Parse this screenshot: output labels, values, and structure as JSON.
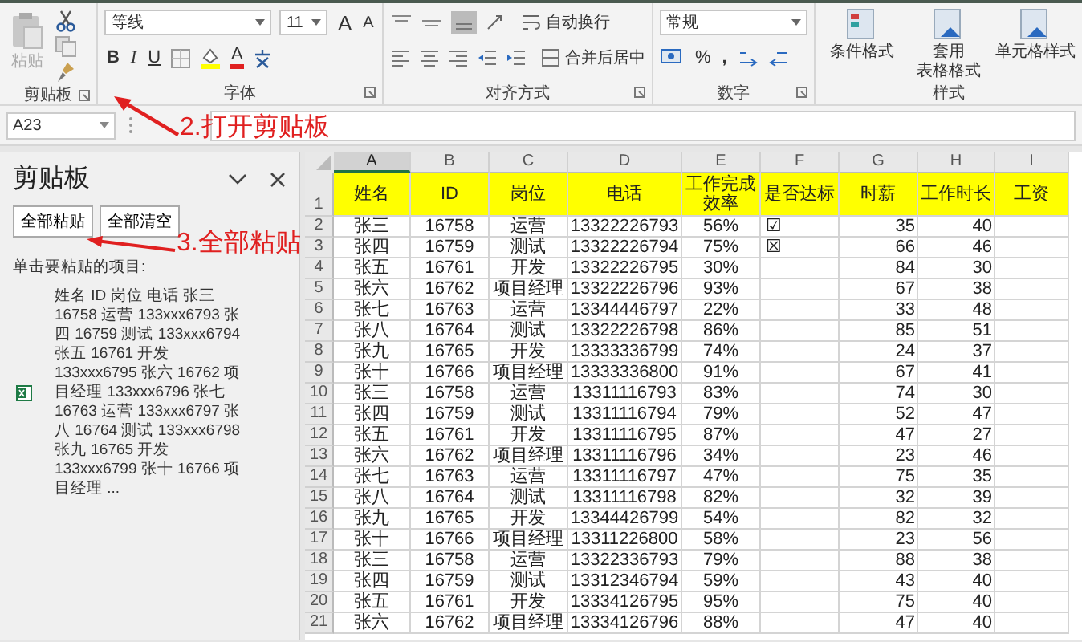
{
  "ribbon": {
    "clipboard": {
      "label": "剪贴板",
      "paste": {
        "label": "粘贴",
        "disabled": true
      }
    },
    "font": {
      "label": "字体",
      "font_name": "等线",
      "font_size": "11",
      "grow": "A",
      "shrink": "A",
      "bold": "B",
      "italic": "I",
      "underline": "U",
      "font_color": "A"
    },
    "alignment": {
      "label": "对齐方式",
      "wrap": "自动换行",
      "merge": "合并后居中"
    },
    "number": {
      "label": "数字",
      "format": "常规",
      "percent": "%",
      "comma": ","
    },
    "styles": {
      "label": "样式",
      "buttons": [
        {
          "lines": [
            "条件格式"
          ]
        },
        {
          "lines": [
            "套用",
            "表格格式"
          ]
        },
        {
          "lines": [
            "单元格样式"
          ]
        }
      ]
    }
  },
  "formula_bar": {
    "name_box": "A23"
  },
  "clipboard_pane": {
    "title": "剪贴板",
    "buttons": [
      "全部粘贴",
      "全部清空"
    ],
    "hint": "单击要粘贴的项目:",
    "items": [
      {
        "text": "姓名 ID 岗位 电话 张三 16758 运营 133xxx6793 张四 16759 测试 133xxx6794 张五 16761 开发 133xxx6795 张六 16762 项目经理 133xxx6796 张七 16763 运营 133xxx6797 张八 16764 测试 133xxx6798 张九 16765 开发 133xxx6799 张十 16766 项目经理 ..."
      }
    ]
  },
  "annotations": [
    {
      "text": "2.打开剪贴板"
    },
    {
      "text": "3.全部粘贴"
    }
  ],
  "sheet": {
    "columns": [
      {
        "label": "A",
        "selected": true
      },
      {
        "label": "B",
        "selected": false
      },
      {
        "label": "C",
        "selected": false
      },
      {
        "label": "D",
        "selected": false
      },
      {
        "label": "E",
        "selected": false
      },
      {
        "label": "F",
        "selected": false
      },
      {
        "label": "G",
        "selected": false
      },
      {
        "label": "H",
        "selected": false
      },
      {
        "label": "I",
        "selected": false
      }
    ],
    "header_row": "1",
    "header": [
      "姓名",
      "ID",
      "岗位",
      "电话",
      "工作完成效率",
      "是否达标",
      "时薪",
      "工作时长",
      "工资"
    ],
    "rows": [
      {
        "row": "2",
        "name": "张三",
        "id": "16758",
        "position": "运营",
        "phone": "13322226793",
        "efficiency": "56%",
        "pass_mark": "☑",
        "hourly_pay": "35",
        "hours": "40"
      },
      {
        "row": "3",
        "name": "张四",
        "id": "16759",
        "position": "测试",
        "phone": "13322226794",
        "efficiency": "75%",
        "pass_mark": "☒",
        "hourly_pay": "66",
        "hours": "46"
      },
      {
        "row": "4",
        "name": "张五",
        "id": "16761",
        "position": "开发",
        "phone": "13322226795",
        "efficiency": "30%",
        "hourly_pay": "84",
        "hours": "30"
      },
      {
        "row": "5",
        "name": "张六",
        "id": "16762",
        "position": "项目经理",
        "phone": "13322226796",
        "efficiency": "93%",
        "hourly_pay": "67",
        "hours": "38"
      },
      {
        "row": "6",
        "name": "张七",
        "id": "16763",
        "position": "运营",
        "phone": "13344446797",
        "efficiency": "22%",
        "hourly_pay": "33",
        "hours": "48"
      },
      {
        "row": "7",
        "name": "张八",
        "id": "16764",
        "position": "测试",
        "phone": "13322226798",
        "efficiency": "86%",
        "hourly_pay": "85",
        "hours": "51"
      },
      {
        "row": "8",
        "name": "张九",
        "id": "16765",
        "position": "开发",
        "phone": "13333336799",
        "efficiency": "74%",
        "hourly_pay": "24",
        "hours": "37"
      },
      {
        "row": "9",
        "name": "张十",
        "id": "16766",
        "position": "项目经理",
        "phone": "13333336800",
        "efficiency": "91%",
        "hourly_pay": "67",
        "hours": "41"
      },
      {
        "row": "10",
        "name": "张三",
        "id": "16758",
        "position": "运营",
        "phone": "13311116793",
        "efficiency": "83%",
        "hourly_pay": "74",
        "hours": "30"
      },
      {
        "row": "11",
        "name": "张四",
        "id": "16759",
        "position": "测试",
        "phone": "13311116794",
        "efficiency": "79%",
        "hourly_pay": "52",
        "hours": "47"
      },
      {
        "row": "12",
        "name": "张五",
        "id": "16761",
        "position": "开发",
        "phone": "13311116795",
        "efficiency": "87%",
        "hourly_pay": "47",
        "hours": "27"
      },
      {
        "row": "13",
        "name": "张六",
        "id": "16762",
        "position": "项目经理",
        "phone": "13311116796",
        "efficiency": "34%",
        "hourly_pay": "23",
        "hours": "46"
      },
      {
        "row": "14",
        "name": "张七",
        "id": "16763",
        "position": "运营",
        "phone": "13311116797",
        "efficiency": "47%",
        "hourly_pay": "75",
        "hours": "35"
      },
      {
        "row": "15",
        "name": "张八",
        "id": "16764",
        "position": "测试",
        "phone": "13311116798",
        "efficiency": "82%",
        "hourly_pay": "32",
        "hours": "39"
      },
      {
        "row": "16",
        "name": "张九",
        "id": "16765",
        "position": "开发",
        "phone": "13344426799",
        "efficiency": "54%",
        "hourly_pay": "82",
        "hours": "32"
      },
      {
        "row": "17",
        "name": "张十",
        "id": "16766",
        "position": "项目经理",
        "phone": "13311226800",
        "efficiency": "58%",
        "hourly_pay": "23",
        "hours": "56"
      },
      {
        "row": "18",
        "name": "张三",
        "id": "16758",
        "position": "运营",
        "phone": "13322336793",
        "efficiency": "79%",
        "hourly_pay": "88",
        "hours": "38"
      },
      {
        "row": "19",
        "name": "张四",
        "id": "16759",
        "position": "测试",
        "phone": "13312346794",
        "efficiency": "59%",
        "hourly_pay": "43",
        "hours": "40"
      },
      {
        "row": "20",
        "name": "张五",
        "id": "16761",
        "position": "开发",
        "phone": "13334126795",
        "efficiency": "95%",
        "hourly_pay": "75",
        "hours": "40"
      },
      {
        "row": "21",
        "name": "张六",
        "id": "16762",
        "position": "项目经理",
        "phone": "13334126796",
        "efficiency": "88%",
        "hourly_pay": "47",
        "hours": "40"
      }
    ]
  }
}
